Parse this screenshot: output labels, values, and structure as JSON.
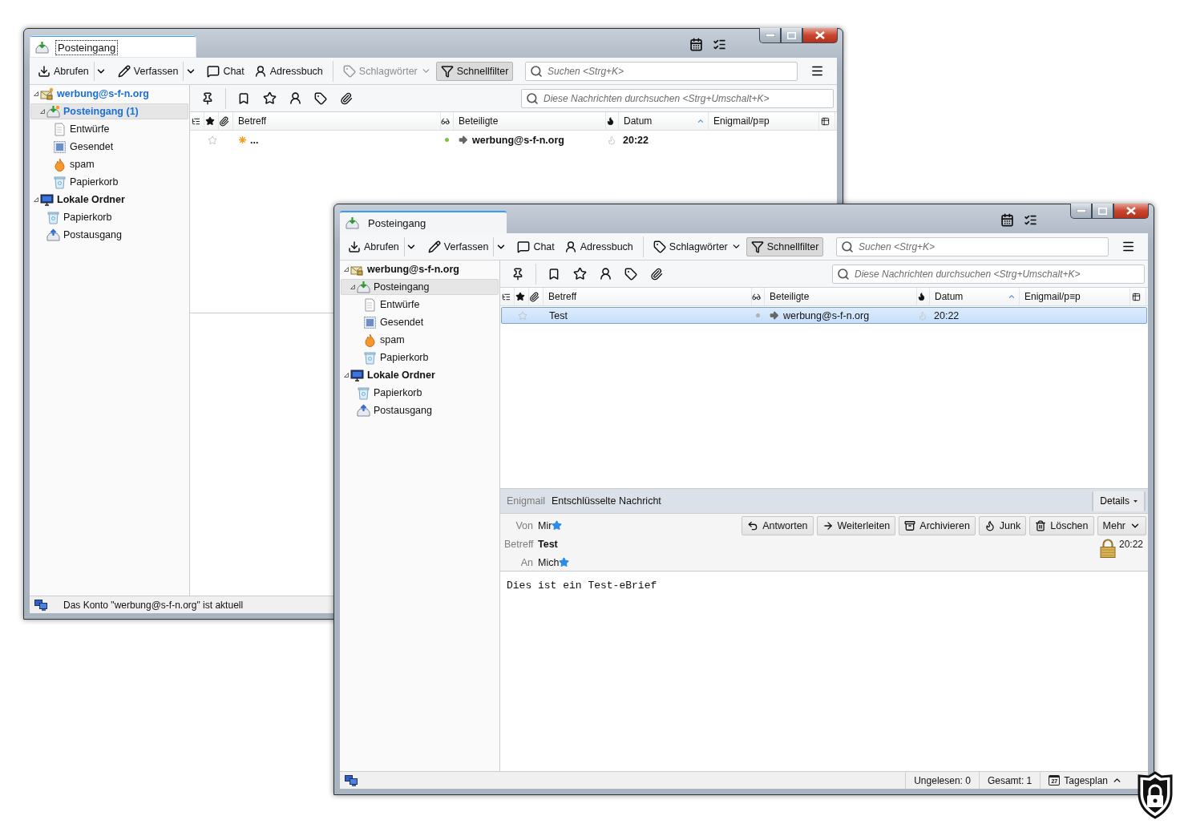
{
  "windows": [
    {
      "tab": {
        "label": "Posteingang",
        "focused": true
      },
      "toolbar": [
        {
          "label": "Abrufen",
          "kind": "split",
          "disabled": false,
          "pressed": false
        },
        {
          "label": "Verfassen",
          "kind": "split",
          "disabled": false,
          "pressed": false
        },
        {
          "label": "Chat",
          "kind": "button",
          "disabled": false,
          "pressed": false
        },
        {
          "label": "Adressbuch",
          "kind": "button",
          "disabled": false,
          "pressed": false
        },
        {
          "label": "Schlagwörter",
          "kind": "menu",
          "disabled": true,
          "pressed": false
        },
        {
          "label": "Schnellfilter",
          "kind": "toggle",
          "disabled": false,
          "pressed": true
        }
      ],
      "search": {
        "placeholder": "Suchen <Strg+K>"
      },
      "quick_filter": {
        "placeholder": "Diese Nachrichten durchsuchen <Strg+Umschalt+K>"
      },
      "folders": [
        {
          "label": "werbung@s-f-n.org",
          "kind": "account",
          "unread": true,
          "selected": false,
          "expanded": true,
          "children": [
            {
              "label": "Posteingang (1)",
              "kind": "inbox",
              "unread": true,
              "selected": true,
              "expanded": true,
              "children": [
                {
                  "label": "Entwürfe",
                  "kind": "drafts",
                  "unread": false,
                  "selected": false
                },
                {
                  "label": "Gesendet",
                  "kind": "sent",
                  "unread": false,
                  "selected": false
                },
                {
                  "label": "spam",
                  "kind": "spam",
                  "unread": false,
                  "selected": false
                },
                {
                  "label": "Papierkorb",
                  "kind": "trash",
                  "unread": false,
                  "selected": false
                }
              ]
            }
          ]
        },
        {
          "label": "Lokale Ordner",
          "kind": "local",
          "unread": false,
          "selected": false,
          "expanded": true,
          "children": [
            {
              "label": "Papierkorb",
              "kind": "trash",
              "unread": false,
              "selected": false
            },
            {
              "label": "Postausgang",
              "kind": "outbox",
              "unread": false,
              "selected": false
            }
          ]
        }
      ],
      "columns": [
        {
          "label": "Betreff",
          "sorted": false
        },
        {
          "label": "Beteiligte",
          "sorted": false
        },
        {
          "label": "Datum",
          "sorted": true
        },
        {
          "label": "Enigmail/p≡p",
          "sorted": false
        }
      ],
      "messages": [
        {
          "subject": "...",
          "correspondent": "werbung@s-f-n.org",
          "date": "20:22",
          "unread": true,
          "new": true,
          "selected": false
        }
      ],
      "status_bar": {
        "text": "Das Konto \"werbung@s-f-n.org\" ist aktuell"
      }
    },
    {
      "tab": {
        "label": "Posteingang",
        "focused": false
      },
      "toolbar": [
        {
          "label": "Abrufen",
          "kind": "split",
          "disabled": false,
          "pressed": false
        },
        {
          "label": "Verfassen",
          "kind": "split",
          "disabled": false,
          "pressed": false
        },
        {
          "label": "Chat",
          "kind": "button",
          "disabled": false,
          "pressed": false
        },
        {
          "label": "Adressbuch",
          "kind": "button",
          "disabled": false,
          "pressed": false
        },
        {
          "label": "Schlagwörter",
          "kind": "menu",
          "disabled": false,
          "pressed": false
        },
        {
          "label": "Schnellfilter",
          "kind": "toggle",
          "disabled": false,
          "pressed": true
        }
      ],
      "search": {
        "placeholder": "Suchen <Strg+K>"
      },
      "quick_filter": {
        "placeholder": "Diese Nachrichten durchsuchen <Strg+Umschalt+K>"
      },
      "folders": [
        {
          "label": "werbung@s-f-n.org",
          "kind": "account",
          "unread": false,
          "selected": false,
          "expanded": true,
          "children": [
            {
              "label": "Posteingang",
              "kind": "inbox",
              "unread": false,
              "selected": true,
              "expanded": true,
              "children": [
                {
                  "label": "Entwürfe",
                  "kind": "drafts",
                  "unread": false,
                  "selected": false
                },
                {
                  "label": "Gesendet",
                  "kind": "sent",
                  "unread": false,
                  "selected": false
                },
                {
                  "label": "spam",
                  "kind": "spam",
                  "unread": false,
                  "selected": false
                },
                {
                  "label": "Papierkorb",
                  "kind": "trash",
                  "unread": false,
                  "selected": false
                }
              ]
            }
          ]
        },
        {
          "label": "Lokale Ordner",
          "kind": "local",
          "unread": false,
          "selected": false,
          "expanded": true,
          "children": [
            {
              "label": "Papierkorb",
              "kind": "trash",
              "unread": false,
              "selected": false
            },
            {
              "label": "Postausgang",
              "kind": "outbox",
              "unread": false,
              "selected": false
            }
          ]
        }
      ],
      "columns": [
        {
          "label": "Betreff",
          "sorted": false
        },
        {
          "label": "Beteiligte",
          "sorted": false
        },
        {
          "label": "Datum",
          "sorted": true
        },
        {
          "label": "Enigmail/p≡p",
          "sorted": false
        }
      ],
      "messages": [
        {
          "subject": "Test",
          "correspondent": "werbung@s-f-n.org",
          "date": "20:22",
          "unread": false,
          "new": false,
          "selected": true
        }
      ],
      "message": {
        "enigmail": {
          "label": "Enigmail",
          "status": "Entschlüsselte Nachricht",
          "details_button": "Details"
        },
        "fields": [
          {
            "label": "Von",
            "value": "Mir",
            "kind": "address",
            "in_address_book": true
          },
          {
            "label": "Betreff",
            "value": "Test",
            "kind": "subject"
          },
          {
            "label": "An",
            "value": "Mich",
            "kind": "address",
            "in_address_book": true
          }
        ],
        "actions": [
          {
            "label": "Antworten",
            "kind": "button"
          },
          {
            "label": "Weiterleiten",
            "kind": "button"
          },
          {
            "label": "Archivieren",
            "kind": "button"
          },
          {
            "label": "Junk",
            "kind": "button"
          },
          {
            "label": "Löschen",
            "kind": "button"
          },
          {
            "label": "Mehr",
            "kind": "menu"
          }
        ],
        "encrypted": true,
        "date": "20:22",
        "body": "Dies ist ein Test-eBrief"
      },
      "status_bar": {
        "unread_count": "Ungelesen: 0",
        "total_count": "Gesamt: 1",
        "today_pane": {
          "label": "Tagesplan",
          "day": "27"
        }
      }
    }
  ]
}
